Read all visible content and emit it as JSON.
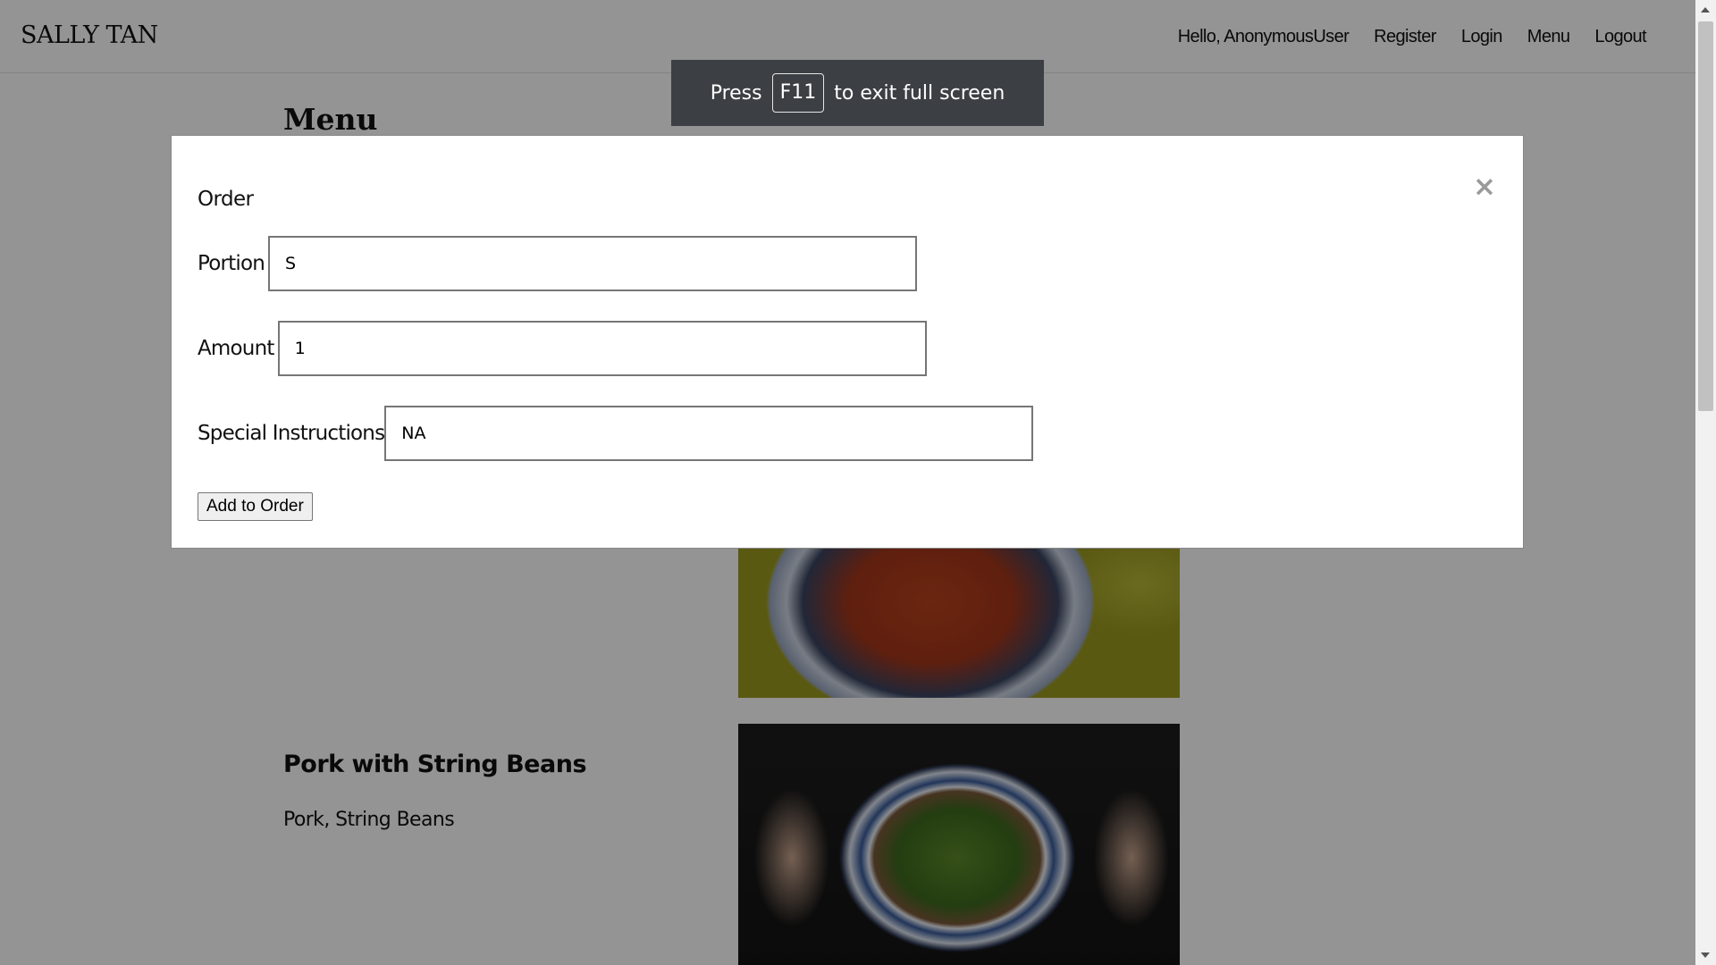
{
  "navbar": {
    "brand": "SALLY TAN",
    "greeting": "Hello, AnonymousUser",
    "links": [
      "Register",
      "Login",
      "Menu",
      "Logout"
    ]
  },
  "page": {
    "heading": "Menu",
    "dishes": [
      {
        "name": "",
        "description": "",
        "photo_icon": "noodle-soup-photo"
      },
      {
        "name": "Pork with String Beans",
        "description": "Pork, String Beans",
        "photo_icon": "pork-string-beans-photo"
      }
    ]
  },
  "fullscreen_notice": {
    "before": "Press",
    "key": "F11",
    "after": "to exit full screen"
  },
  "modal": {
    "title": "Order",
    "close_symbol": "×",
    "fields": {
      "portion": {
        "label": "Portion",
        "value": "S"
      },
      "amount": {
        "label": "Amount",
        "value": "1"
      },
      "instructions": {
        "label": "Special Instructions",
        "value": "NA"
      }
    },
    "submit_label": "Add to Order"
  },
  "colors": {
    "backdrop": "rgba(0,0,0,0.42)",
    "notice_bg": "#3c3f43",
    "close_icon": "#9a9a9a"
  }
}
